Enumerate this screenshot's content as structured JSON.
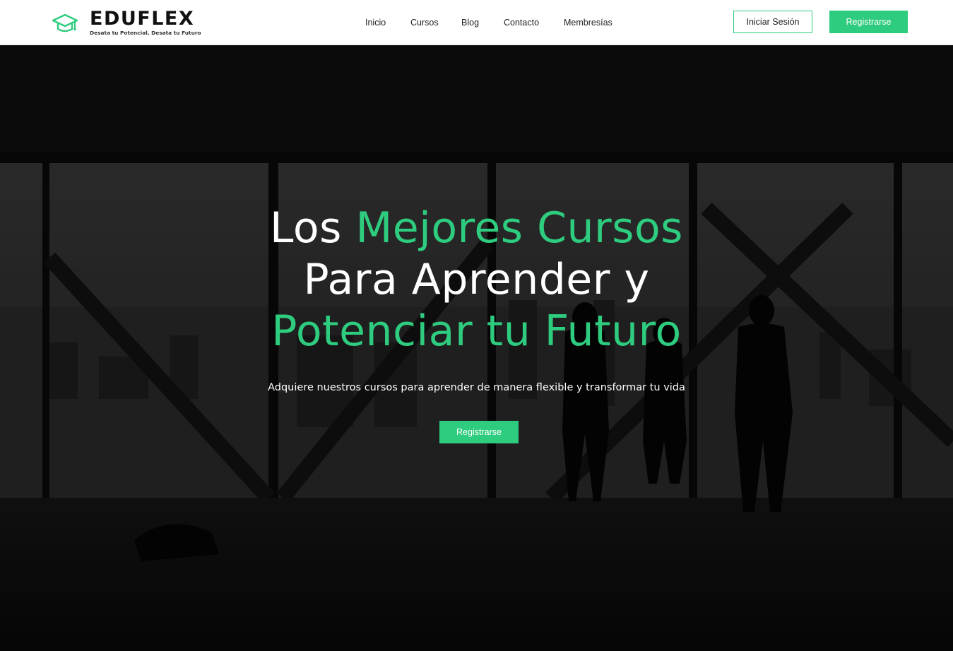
{
  "brand": {
    "name": "EDUFLEX",
    "tagline": "Desata tu Potencial, Desata tu Futuro",
    "icon": "graduation-cap-icon",
    "accent_color": "#2ecc7e"
  },
  "nav": {
    "items": [
      {
        "label": "Inicio"
      },
      {
        "label": "Cursos"
      },
      {
        "label": "Blog"
      },
      {
        "label": "Contacto"
      },
      {
        "label": "Membresías"
      }
    ]
  },
  "header_actions": {
    "login_label": "Iniciar Sesión",
    "register_label": "Registrarse"
  },
  "hero": {
    "title_parts": {
      "l1_white": "Los",
      "l1_green": "Mejores Cursos",
      "l2_white": "Para Aprender y",
      "l3_green": "Potenciar tu Futuro"
    },
    "subtitle": "Adquiere nuestros cursos para aprender de manera flexible y transformar tu vida",
    "cta_label": "Registrarse"
  }
}
